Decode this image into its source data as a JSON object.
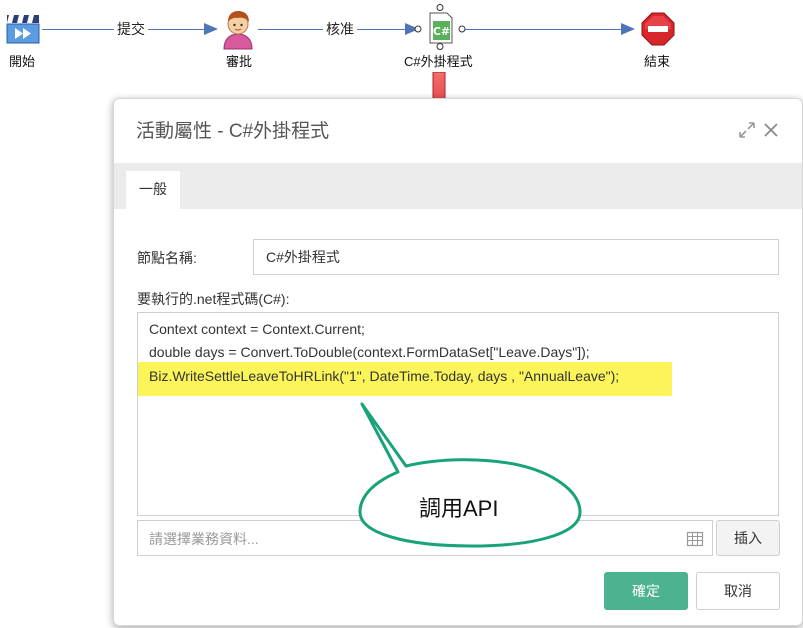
{
  "workflow": {
    "nodes": [
      {
        "label": "開始",
        "icon": "start-clapper-icon"
      },
      {
        "label": "審批",
        "icon": "user-approver-icon"
      },
      {
        "label": "C#外掛程式",
        "icon": "csharp-plugin-icon"
      },
      {
        "label": "結束",
        "icon": "stop-end-icon"
      }
    ],
    "edges": [
      {
        "label": "提交"
      },
      {
        "label": "核准"
      },
      {
        "label": ""
      }
    ],
    "line_color": "#4f74b8"
  },
  "dialog": {
    "title": "活動屬性 - C#外掛程式",
    "header_icons": [
      "expand-icon",
      "close-icon"
    ],
    "tabs": [
      {
        "label": "一般",
        "active": true
      }
    ],
    "node_name": {
      "label": "節點名稱:",
      "value": "C#外掛程式"
    },
    "code": {
      "label": "要執行的.net程式碼(C#):",
      "lines": [
        "Context context = Context.Current;",
        "double days = Convert.ToDouble(context.FormDataSet[\"Leave.Days\"]);",
        "Biz.WriteSettleLeaveToHRLink(\"1\", DateTime.Today, days , \"AnnualLeave\");"
      ],
      "highlight_color": "#fbf55a"
    },
    "business_data": {
      "placeholder": "請選擇業務資料...",
      "icon": "table-grid-icon",
      "insert_label": "插入"
    },
    "buttons": {
      "ok_label": "確定",
      "cancel_label": "取消",
      "ok_color": "#4db290"
    }
  },
  "annotation": {
    "callout_text": "調用API",
    "callout_color": "#1aa37a",
    "arrow_color": "#e8353a"
  }
}
